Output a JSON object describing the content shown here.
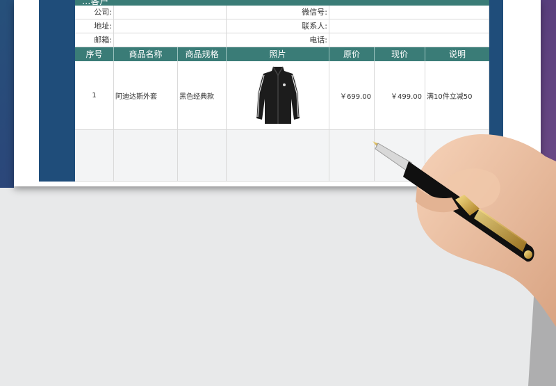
{
  "sheet": {
    "title": "...客户"
  },
  "info": [
    {
      "left_label": "公司:",
      "left_value": "",
      "right_label": "微信号:",
      "right_value": ""
    },
    {
      "left_label": "地址:",
      "left_value": "",
      "right_label": "联系人:",
      "right_value": ""
    },
    {
      "left_label": "邮箱:",
      "left_value": "",
      "right_label": "电话:",
      "right_value": ""
    }
  ],
  "table": {
    "headers": [
      "序号",
      "商品名称",
      "商品规格",
      "照片",
      "原价",
      "现价",
      "说明"
    ],
    "rows": [
      {
        "index": "1",
        "name": "阿迪达斯外套",
        "spec": "黑色经典款",
        "photo": "jacket-photo",
        "original_price": "￥699.00",
        "current_price": "￥499.00",
        "note": "满10件立减50"
      },
      {
        "index": "",
        "name": "",
        "spec": "",
        "photo": "",
        "original_price": "",
        "current_price": "",
        "note": ""
      }
    ]
  },
  "colors": {
    "header_bg": "#3a7c77",
    "sidebar_bg": "#1f4d7a"
  },
  "icons": {
    "decor_pen": "fountain-pen-in-hand"
  }
}
